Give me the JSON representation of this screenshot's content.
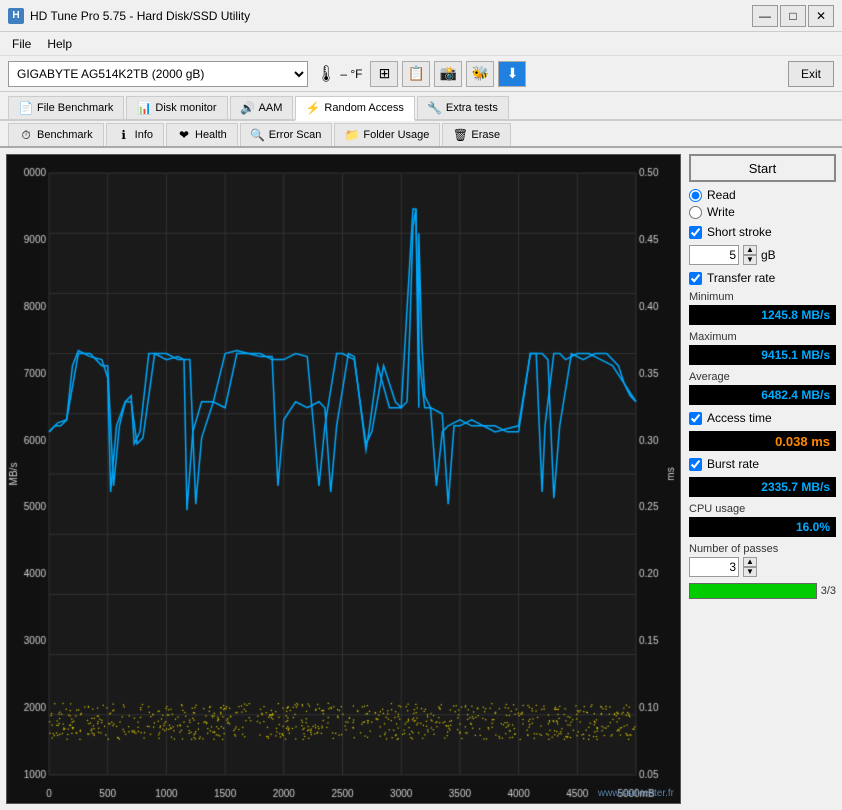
{
  "titleBar": {
    "title": "HD Tune Pro 5.75 - Hard Disk/SSD Utility",
    "minimizeLabel": "—",
    "maximizeLabel": "□",
    "closeLabel": "✕"
  },
  "menuBar": {
    "file": "File",
    "help": "Help"
  },
  "driveBar": {
    "driveLabel": "GIGABYTE AG514K2TB (2000 gB)",
    "tempLabel": "– °F",
    "exitLabel": "Exit"
  },
  "tabs": {
    "row1": [
      {
        "id": "file-benchmark",
        "label": "File Benchmark",
        "icon": "📄"
      },
      {
        "id": "disk-monitor",
        "label": "Disk monitor",
        "icon": "📊"
      },
      {
        "id": "aam",
        "label": "AAM",
        "icon": "🔊"
      },
      {
        "id": "random-access",
        "label": "Random Access",
        "icon": "⚡",
        "active": true
      },
      {
        "id": "extra-tests",
        "label": "Extra tests",
        "icon": "🔧"
      }
    ],
    "row2": [
      {
        "id": "benchmark",
        "label": "Benchmark",
        "icon": "⏱"
      },
      {
        "id": "info",
        "label": "Info",
        "icon": "ℹ"
      },
      {
        "id": "health",
        "label": "Health",
        "icon": "❤"
      },
      {
        "id": "error-scan",
        "label": "Error Scan",
        "icon": "🔍"
      },
      {
        "id": "folder-usage",
        "label": "Folder Usage",
        "icon": "📁"
      },
      {
        "id": "erase",
        "label": "Erase",
        "icon": "🗑"
      }
    ]
  },
  "controls": {
    "startLabel": "Start",
    "readLabel": "Read",
    "writeLabel": "Write",
    "shortStrokeLabel": "Short stroke",
    "shortStrokeValue": "5",
    "shortStrokeUnit": "gB",
    "transferRateLabel": "Transfer rate",
    "minimumLabel": "Minimum",
    "minimumValue": "1245.8 MB/s",
    "maximumLabel": "Maximum",
    "maximumValue": "9415.1 MB/s",
    "averageLabel": "Average",
    "averageValue": "6482.4 MB/s",
    "accessTimeLabel": "Access time",
    "accessTimeValue": "0.038 ms",
    "burstRateLabel": "Burst rate",
    "burstRateValue": "2335.7 MB/s",
    "cpuUsageLabel": "CPU usage",
    "cpuUsageValue": "16.0%",
    "numberOfPassesLabel": "Number of passes",
    "numberOfPassesValue": "3",
    "progressLabel": "3/3",
    "progressPercent": 100
  },
  "chart": {
    "yLeftLabel": "MB/s",
    "yRightLabel": "ms",
    "xLabel": "mB",
    "yLeftTicks": [
      "0000",
      "9000",
      "8000",
      "7000",
      "6000",
      "5000",
      "4000",
      "3000",
      "2000",
      "1000"
    ],
    "yRightTicks": [
      "0.50",
      "0.45",
      "0.40",
      "0.35",
      "0.30",
      "0.25",
      "0.20",
      "0.15",
      "0.10",
      "0.05"
    ],
    "xTicks": [
      "0",
      "500",
      "1000",
      "1500",
      "2000",
      "2500",
      "3000",
      "3500",
      "4000",
      "4500",
      "5000"
    ]
  },
  "watermark": "www.ssd-tester.fr"
}
